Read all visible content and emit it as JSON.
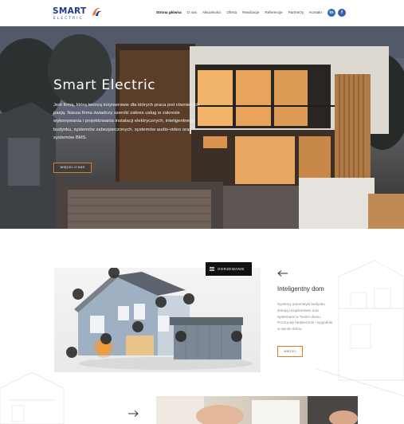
{
  "brand": {
    "name": "SMART",
    "sub": "ELECTRIC",
    "accent": "#e07b28",
    "primary": "#1f3a93"
  },
  "nav": {
    "items": [
      {
        "label": "Strona główna",
        "active": true
      },
      {
        "label": "O nas"
      },
      {
        "label": "Aktualności"
      },
      {
        "label": "Oferta"
      },
      {
        "label": "Realizacje"
      },
      {
        "label": "Referencje"
      },
      {
        "label": "Partnerzy"
      },
      {
        "label": "Kontakt"
      }
    ]
  },
  "social": {
    "linkedin": "in",
    "facebook": "f"
  },
  "hero": {
    "title": "Smart Electric",
    "text": "Jest firmą, którą tworzą inżynierowie dla których praca jest również ich pasją. Nasza firma świadczy szeroki zakres usług w zakresie wykonywania i projektowania instalacji elektrycznych, inteligentnego budynku, systemów zabezpieczonych, systemów audio-video oraz systemów BMS.",
    "button": "WIĘCEJ O NAS"
  },
  "feature": {
    "badge": "OGRZEWANIE",
    "title": "Inteligentny dom",
    "text": "Systemy automatyki budynku sterują urządzeniami oraz systemami w Twoim domu. Poczuj się bezpiecznie i wygodnie w swoim domu.",
    "button": "WIĘCEJ"
  }
}
